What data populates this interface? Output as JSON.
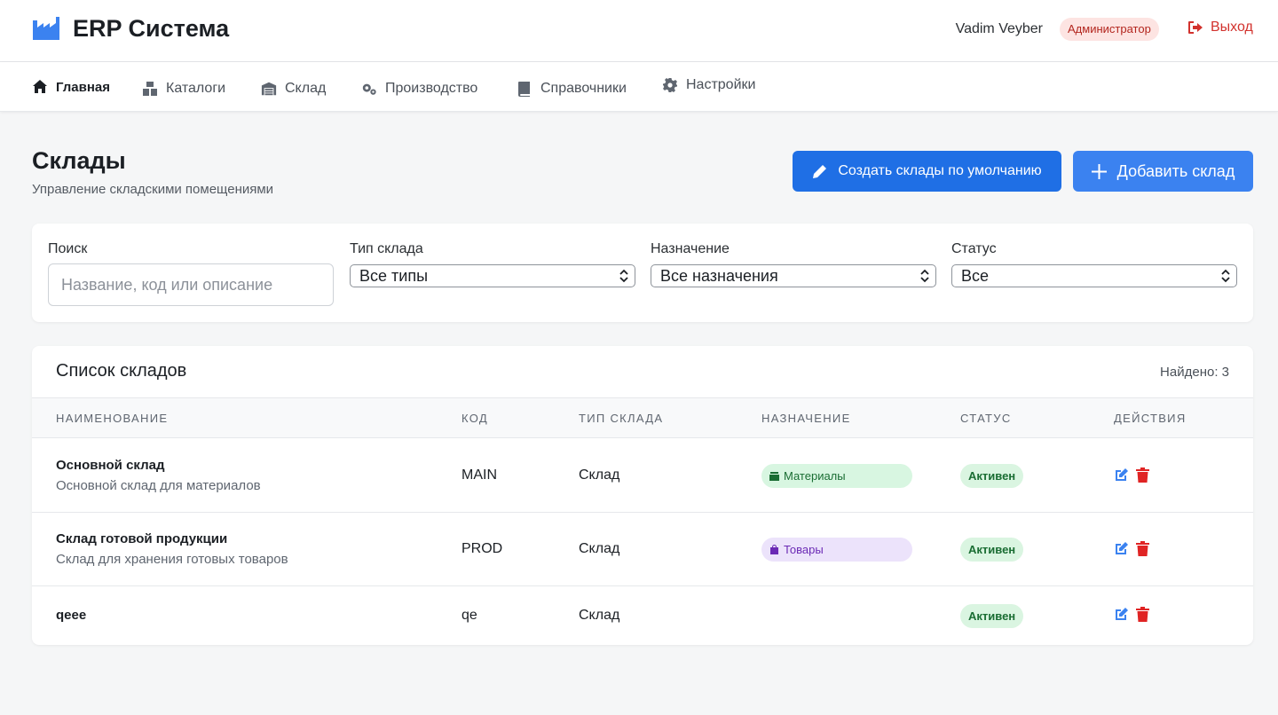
{
  "header": {
    "app_title": "ERP Система",
    "user_name": "Vadim Veyber",
    "role": "Администратор",
    "logout_label": "Выход"
  },
  "nav": {
    "items": [
      {
        "label": "Главная",
        "icon": "home-icon"
      },
      {
        "label": "Каталоги",
        "icon": "catalog-icon"
      },
      {
        "label": "Склад",
        "icon": "warehouse-icon"
      },
      {
        "label": "Производство",
        "icon": "cogs-icon"
      },
      {
        "label": "Справочники",
        "icon": "book-icon"
      },
      {
        "label": "Настройки",
        "icon": "gear-icon"
      }
    ]
  },
  "page": {
    "title": "Склады",
    "subtitle": "Управление складскими помещениями",
    "create_defaults_label": "Создать склады по умолчанию",
    "add_label": "Добавить склад"
  },
  "filters": {
    "search_label": "Поиск",
    "search_placeholder": "Название, код или описание",
    "type_label": "Тип склада",
    "type_value": "Все типы",
    "purpose_label": "Назначение",
    "purpose_value": "Все назначения",
    "status_label": "Статус",
    "status_value": "Все"
  },
  "list": {
    "title": "Список складов",
    "found": "Найдено: 3",
    "columns": [
      "НАИМЕНОВАНИЕ",
      "КОД",
      "ТИП СКЛАДА",
      "НАЗНАЧЕНИЕ",
      "СТАТУС",
      "ДЕЙСТВИЯ"
    ],
    "rows": [
      {
        "name": "Основной склад",
        "description": "Основной склад для материалов",
        "code": "MAIN",
        "type": "Склад",
        "purpose": "Материалы",
        "status": "Активен"
      },
      {
        "name": "Склад готовой продукции",
        "description": "Склад для хранения готовых товаров",
        "code": "PROD",
        "type": "Склад",
        "purpose": "Товары",
        "status": "Активен"
      },
      {
        "name": "qeee",
        "description": "",
        "code": "qe",
        "type": "Склад",
        "purpose": "",
        "status": "Активен"
      }
    ]
  },
  "colors": {
    "primary": "#1f6fe5",
    "danger": "#d2322d",
    "success_bg": "#daf5e1",
    "success_text": "#1a6d33"
  }
}
